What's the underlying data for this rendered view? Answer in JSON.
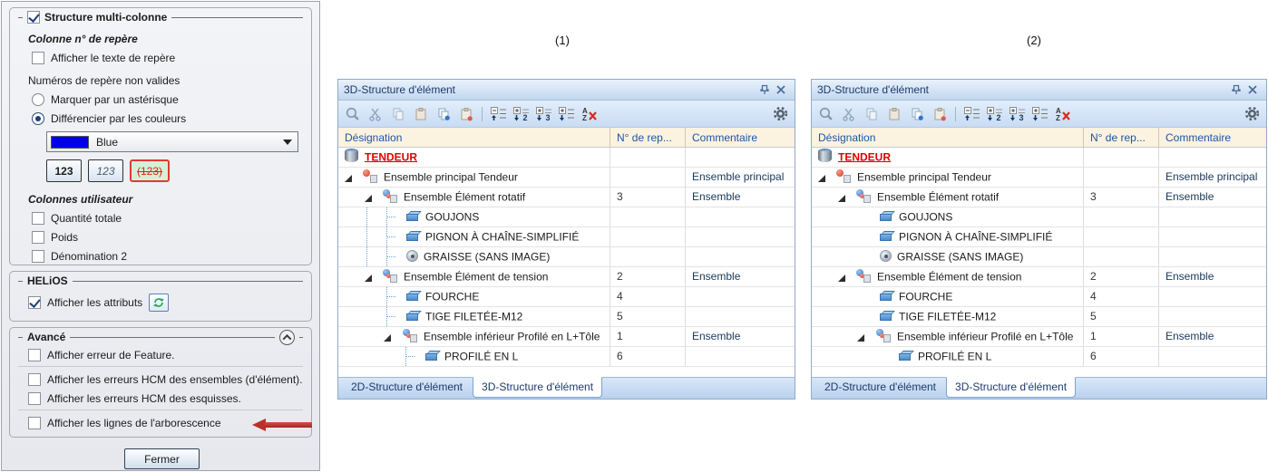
{
  "dialog": {
    "group_structure": {
      "title": "Structure multi-colonne",
      "checked": true,
      "col_repere_label": "Colonne n° de repère",
      "cb_texte_repere": {
        "label": "Afficher le texte de repère",
        "checked": false
      },
      "invalid_label": "Numéros de repère non valides",
      "radio_asterisque": {
        "label": "Marquer par un astérisque",
        "selected": false
      },
      "radio_couleurs": {
        "label": "Différencier par les couleurs",
        "selected": true
      },
      "color_dropdown": {
        "value": "Blue",
        "swatch_hex": "#0000f0"
      },
      "btn_normal": "123",
      "btn_italic": "123",
      "btn_invalid": "(123)",
      "user_cols_label": "Colonnes utilisateur",
      "cb_quantite": {
        "label": "Quantité totale",
        "checked": false
      },
      "cb_poids": {
        "label": "Poids",
        "checked": false
      },
      "cb_denomination": {
        "label": "Dénomination 2",
        "checked": false
      }
    },
    "group_helios": {
      "title": "HELiOS",
      "cb_attributs": {
        "label": "Afficher les attributs",
        "checked": true
      },
      "refresh_icon": "refresh-icon"
    },
    "group_avance": {
      "title": "Avancé",
      "cb_feature": {
        "label": "Afficher erreur de Feature.",
        "checked": false
      },
      "cb_hcm_ensembles": {
        "label": "Afficher les erreurs HCM des ensembles (d'élément).",
        "checked": false
      },
      "cb_hcm_esquisses": {
        "label": "Afficher les erreurs HCM des esquisses.",
        "checked": false
      },
      "cb_arborescence": {
        "label": "Afficher les lignes de l'arborescence",
        "checked": false
      },
      "arrow_color": "#b8322a"
    },
    "close_button": "Fermer"
  },
  "annotations": {
    "label1": "(1)",
    "label2": "(2)"
  },
  "panel": {
    "title": "3D-Structure d'élément",
    "columns": {
      "designation": "Désignation",
      "repere": "N° de rep...",
      "commentaire": "Commentaire"
    },
    "toolbar_icons": [
      "search",
      "cut",
      "copy",
      "paste",
      "copy-special",
      "paste-special",
      "collapse-all",
      "expand-level-2",
      "expand-level-3",
      "expand-all",
      "remove-sort",
      "settings-gear"
    ],
    "titlebar_icons": [
      "pin",
      "close"
    ],
    "tabs": {
      "tab2d": "2D-Structure d'élément",
      "tab3d": "3D-Structure d'élément",
      "active": "3D-Structure d'élément"
    },
    "colors": {
      "header_bg": "#fcf2e0",
      "header_text": "#1857a5",
      "title_text": "#1c3a6b",
      "root_red": "#e00000",
      "comment_navy": "#17375e",
      "treeline_blue": "#69a0d6"
    }
  },
  "rows": [
    {
      "name": "TENDEUR",
      "num": "",
      "comment": "",
      "type": "scene-root",
      "indent": 0
    },
    {
      "name": "Ensemble principal Tendeur",
      "num": "",
      "comment": "Ensemble principal",
      "type": "assembly",
      "indent": 1,
      "expanded": true
    },
    {
      "name": "Ensemble Élément rotatif",
      "num": "3",
      "comment": "Ensemble",
      "type": "assembly",
      "indent": 2,
      "expanded": true
    },
    {
      "name": "GOUJONS",
      "num": "",
      "comment": "",
      "type": "part",
      "indent": 3
    },
    {
      "name": "PIGNON À CHAÎNE-SIMPLIFIÉ",
      "num": "",
      "comment": "",
      "type": "part",
      "indent": 3
    },
    {
      "name": "GRAISSE (SANS IMAGE)",
      "num": "",
      "comment": "",
      "type": "grease",
      "indent": 3
    },
    {
      "name": "Ensemble Élément de tension",
      "num": "2",
      "comment": "Ensemble",
      "type": "assembly",
      "indent": 2,
      "expanded": true
    },
    {
      "name": "FOURCHE",
      "num": "4",
      "comment": "",
      "type": "part",
      "indent": 3
    },
    {
      "name": "TIGE FILETÉE-M12",
      "num": "5",
      "comment": "",
      "type": "part",
      "indent": 3
    },
    {
      "name": "Ensemble inférieur Profilé en L+Tôle",
      "num": "1",
      "comment": "Ensemble",
      "type": "assembly",
      "indent": 3,
      "expanded": true
    },
    {
      "name": "PROFILÉ EN L",
      "num": "6",
      "comment": "",
      "type": "part",
      "indent": 4
    }
  ],
  "panel_difference": {
    "panel1_tree_lines": true,
    "panel2_tree_lines": false
  }
}
